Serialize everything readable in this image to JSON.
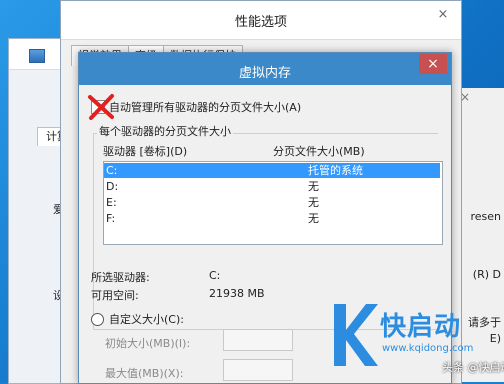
{
  "perf_window": {
    "title": "性能选项",
    "close_label": "×",
    "tabs": [
      "视觉效果",
      "高级",
      "数据执行保护"
    ]
  },
  "back_window": {
    "tab_label": "计算",
    "frag1": "爱",
    "frag2": "设"
  },
  "right_window": {
    "close_label": "×",
    "frag1": "resen",
    "frag2": "(R) D",
    "frag3": "请多于",
    "frag4": "E)"
  },
  "vm_dialog": {
    "title": "虚拟内存",
    "close_label": "×",
    "auto_manage_label": "自动管理所有驱动器的分页文件大小(A)",
    "group_label": "每个驱动器的分页文件大小",
    "col_drive": "驱动器 [卷标](D)",
    "col_size": "分页文件大小(MB)",
    "drives": [
      {
        "drive": "C:",
        "size": "托管的系统"
      },
      {
        "drive": "D:",
        "size": "无"
      },
      {
        "drive": "E:",
        "size": "无"
      },
      {
        "drive": "F:",
        "size": "无"
      }
    ],
    "selected_drive_label": "所选驱动器:",
    "selected_drive_value": "C:",
    "free_space_label": "可用空间:",
    "free_space_value": "21938 MB",
    "custom_size_label": "自定义大小(C):",
    "initial_size_label": "初始大小(MB)(I):",
    "max_size_label": "最大值(MB)(X):"
  },
  "watermark": {
    "brand": "快启动",
    "url": "www.kqidong.com",
    "credit": "头条 @快启动",
    "brand_color": "#2c8de0"
  }
}
